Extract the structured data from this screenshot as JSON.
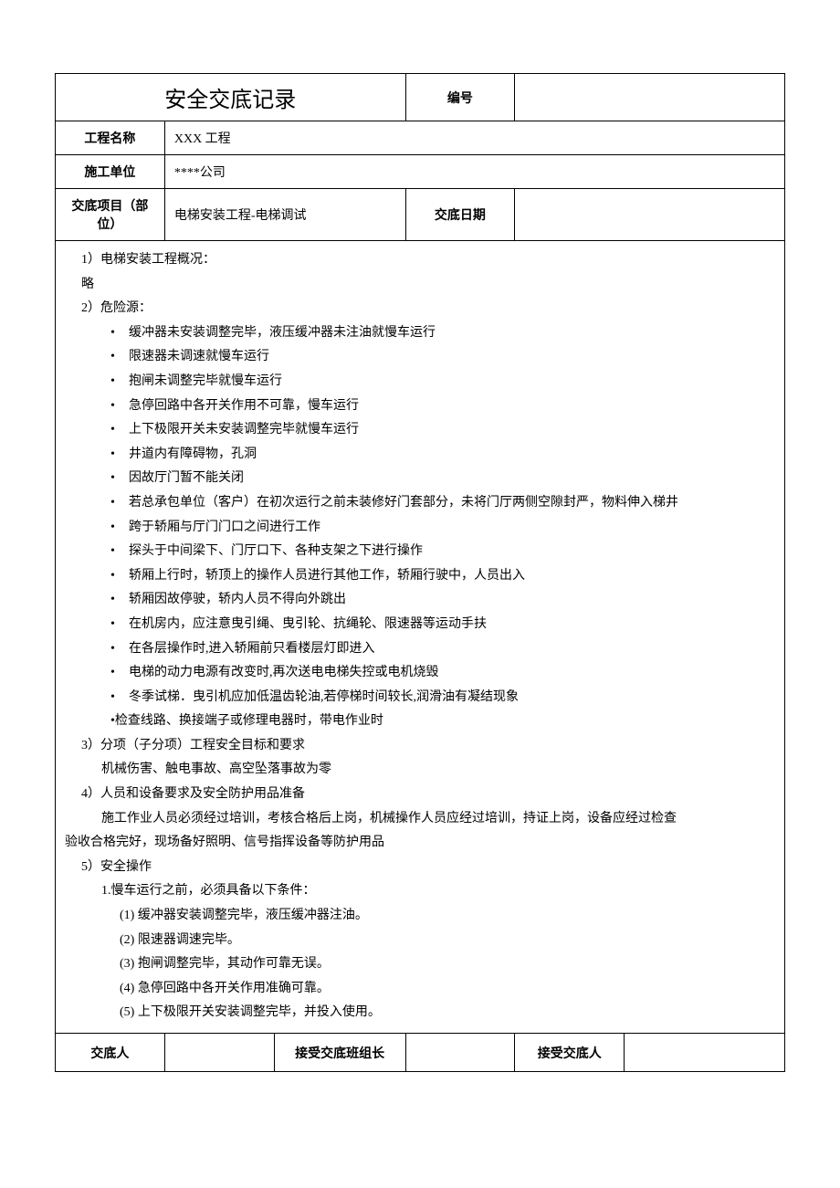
{
  "title": "安全交底记录",
  "header": {
    "numberLabel": "编号",
    "numberValue": "",
    "projectNameLabel": "工程名称",
    "projectNameValue": "XXX 工程",
    "constructionUnitLabel": "施工单位",
    "constructionUnitValue": "****公司",
    "disclosureItemLabel": "交底项目（部位）",
    "disclosureItemValue": "电梯安装工程-电梯调试",
    "disclosureDateLabel": "交底日期",
    "disclosureDateValue": ""
  },
  "sections": {
    "s1": {
      "heading": "1）电梯安装工程概况：",
      "body": "略"
    },
    "s2": {
      "heading": "2）危险源：",
      "bullets": [
        "缓冲器未安装调整完毕，液压缓冲器未注油就慢车运行",
        "限速器未调速就慢车运行",
        "抱闸未调整完毕就慢车运行",
        "急停回路中各开关作用不可靠，慢车运行",
        "上下极限开关未安装调整完毕就慢车运行",
        "井道内有障碍物，孔洞",
        "因故厅门暂不能关闭",
        "若总承包单位（客户）在初次运行之前未装修好门套部分，未将门厅两侧空隙封严，物料伸入梯井",
        "跨于轿厢与厅门门口之间进行工作",
        "探头于中间梁下、门厅口下、各种支架之下进行操作",
        "轿厢上行时，轿顶上的操作人员进行其他工作，轿厢行驶中，人员出入",
        "轿厢因故停驶，轿内人员不得向外跳出",
        "在机房内，应注意曳引绳、曳引轮、抗绳轮、限速器等运动手扶",
        "在各层操作时,进入轿厢前只看楼层灯即进入",
        "电梯的动力电源有改变时,再次送电电梯失控或电机烧毁",
        "冬季试梯．曳引机应加低温齿轮油,若停梯时间较长,润滑油有凝结现象"
      ],
      "lastBullet": "•检查线路、换接端子或修理电器时，带电作业时"
    },
    "s3": {
      "heading": "3）分项（子分项）工程安全目标和要求",
      "body": "机械伤害、触电事故、高空坠落事故为零"
    },
    "s4": {
      "heading": "4）人员和设备要求及安全防护用品准备",
      "body1": "施工作业人员必须经过培训，考核合格后上岗，机械操作人员应经过培训，持证上岗，设备应经过检查",
      "body2": "验收合格完好，现场备好照明、信号指挥设备等防护用品"
    },
    "s5": {
      "heading": "5）安全操作",
      "subheading": "1.慢车运行之前，必须具备以下条件：",
      "items": [
        "(1) 缓冲器安装调整完毕，液压缓冲器注油。",
        "(2) 限速器调速完毕。",
        "(3) 抱闸调整完毕，其动作可靠无误。",
        "(4) 急停回路中各开关作用准确可靠。",
        "(5) 上下极限开关安装调整完毕，并投入使用。"
      ]
    }
  },
  "footer": {
    "discloserLabel": "交底人",
    "discloserValue": "",
    "teamLeaderLabel": "接受交底班组长",
    "teamLeaderValue": "",
    "receiverLabel": "接受交底人",
    "receiverValue": ""
  }
}
